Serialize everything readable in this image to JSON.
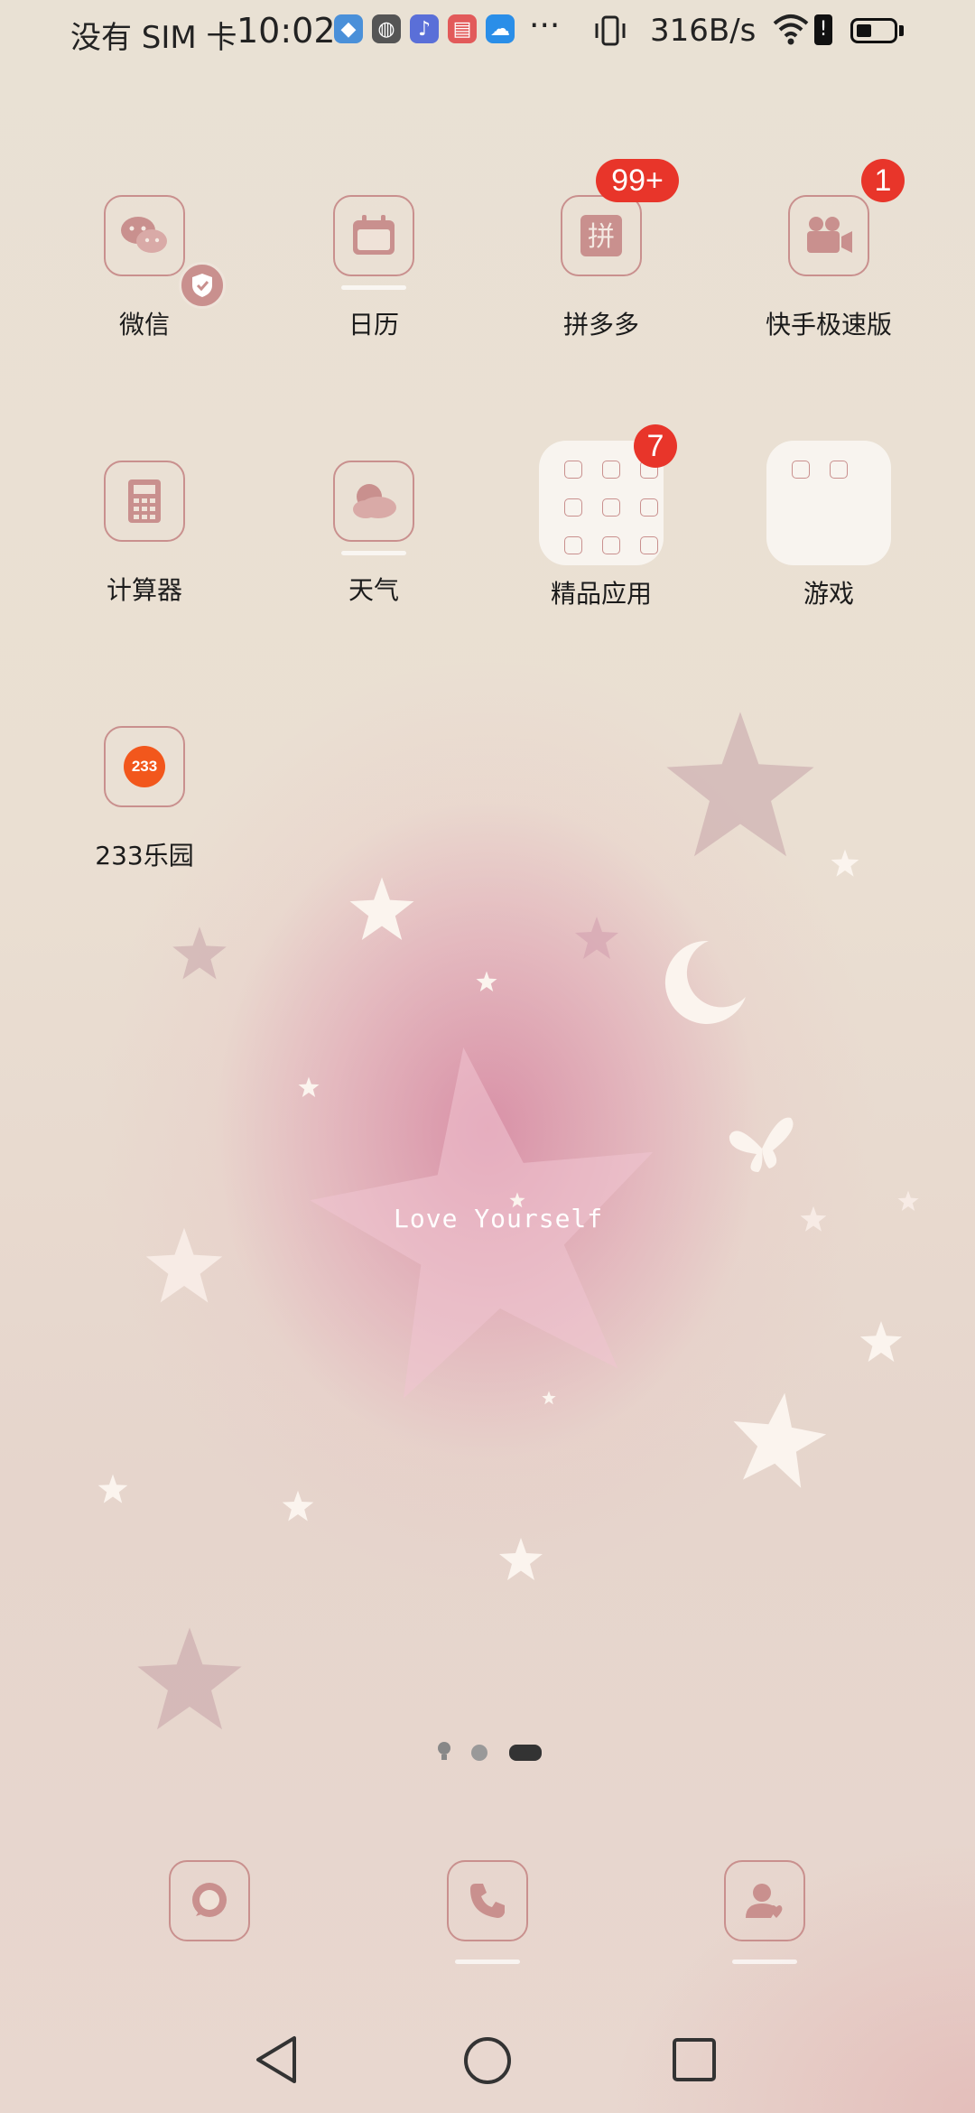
{
  "status_bar": {
    "sim_text": "没有 SIM 卡",
    "time": "10:02",
    "more": "···",
    "net_speed": "316B/s",
    "battery": "low"
  },
  "apps": [
    {
      "label": "微信",
      "icon": "wechat-icon"
    },
    {
      "label": "日历",
      "icon": "calendar-icon"
    },
    {
      "label": "拼多多",
      "icon": "pinduoduo-icon",
      "badge": "99+"
    },
    {
      "label": "快手极速版",
      "icon": "video-camera-icon",
      "badge": "1"
    },
    {
      "label": "计算器",
      "icon": "calculator-icon"
    },
    {
      "label": "天气",
      "icon": "weather-cloud-icon"
    },
    {
      "label": "精品应用",
      "icon": "folder-icon",
      "badge": "7"
    },
    {
      "label": "游戏",
      "icon": "folder-icon"
    },
    {
      "label": "233乐园",
      "icon": "app-233-icon",
      "icon_text": "233"
    }
  ],
  "wallpaper": {
    "text": "Love Yourself"
  },
  "dock": [
    {
      "icon": "messages-icon"
    },
    {
      "icon": "phone-icon"
    },
    {
      "icon": "contacts-icon"
    }
  ],
  "colors": {
    "accent": "#c9908e",
    "badge": "#e8352a",
    "app_233": "#f2571c"
  }
}
